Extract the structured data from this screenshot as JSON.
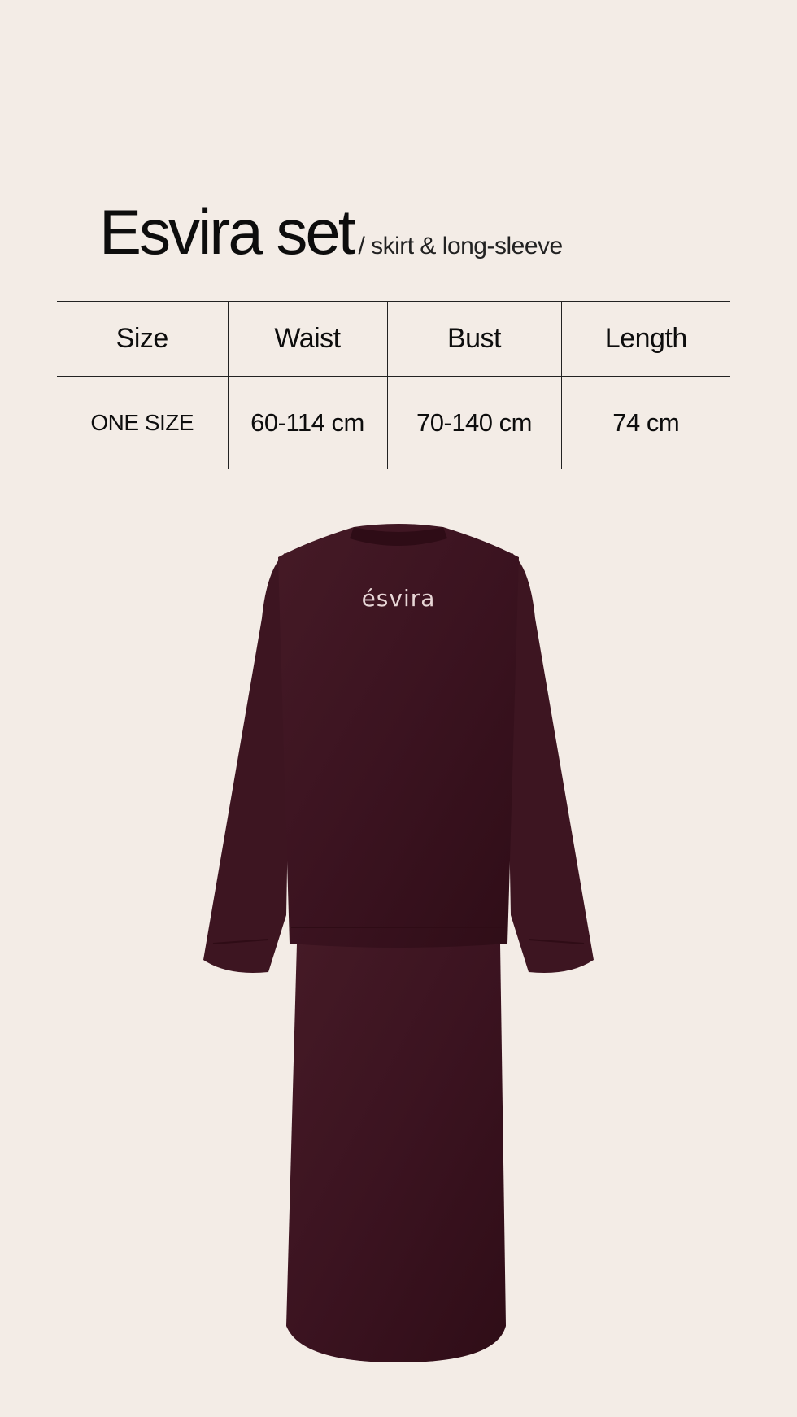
{
  "product": {
    "title": "Esvira set",
    "subtitle": "/ skirt & long-sleeve",
    "logo_text": "ésvira",
    "garment_color": "#3e1520"
  },
  "size_table": {
    "headers": [
      "Size",
      "Waist",
      "Bust",
      "Length"
    ],
    "rows": [
      [
        "ONE SIZE",
        "60-114 cm",
        "70-140 cm",
        "74 cm"
      ]
    ]
  },
  "colors": {
    "background": "#f3ece6",
    "text": "#0d0d0d",
    "rule": "#222222"
  }
}
